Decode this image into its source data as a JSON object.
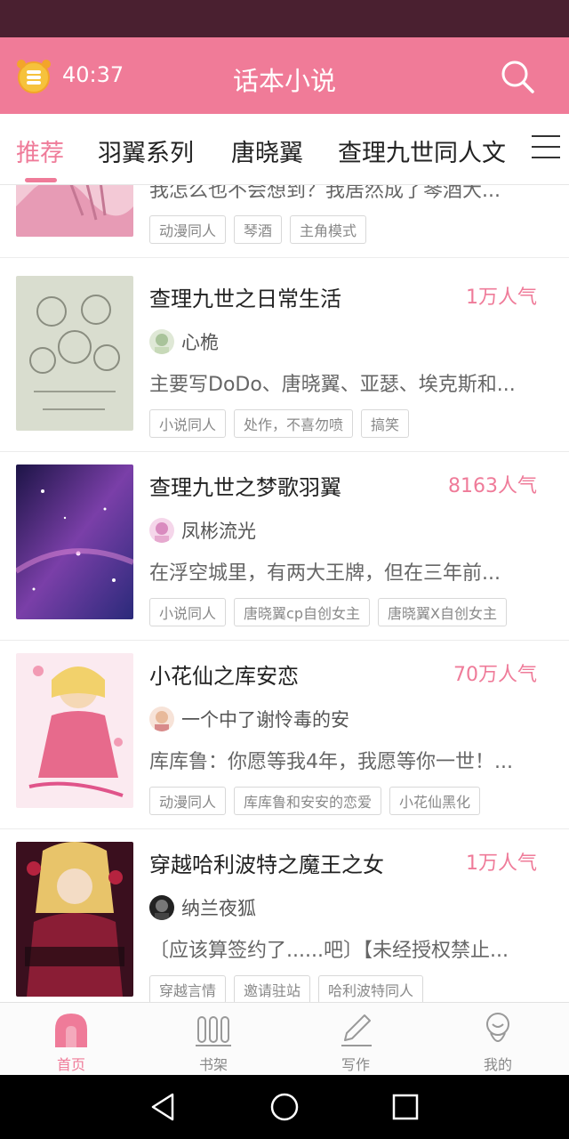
{
  "header": {
    "timer": "40:37",
    "title": "话本小说"
  },
  "tabs": [
    {
      "label": "推荐",
      "active": true
    },
    {
      "label": "羽翼系列",
      "active": false
    },
    {
      "label": "唐晓翼",
      "active": false
    },
    {
      "label": "查理九世同人文",
      "active": false
    }
  ],
  "books": [
    {
      "title": "",
      "popularity": "",
      "author": "",
      "intro": "我怎么也不会想到？我居然成了琴酒大...",
      "tags": [
        "动漫同人",
        "琴酒",
        "主角模式"
      ]
    },
    {
      "title": "查理九世之日常生活",
      "popularity": "1万人气",
      "author": "心桅",
      "intro": "主要写DoDo、唐晓翼、亚瑟、埃克斯和...",
      "tags": [
        "小说同人",
        "处作，不喜勿喷",
        "搞笑"
      ]
    },
    {
      "title": "查理九世之梦歌羽翼",
      "popularity": "8163人气",
      "author": "凤彬流光",
      "intro": "在浮空城里，有两大王牌，但在三年前...",
      "tags": [
        "小说同人",
        "唐晓翼cp自创女主",
        "唐晓翼X自创女主"
      ]
    },
    {
      "title": "小花仙之库安恋",
      "popularity": "70万人气",
      "author": "一个中了谢怜毒的安",
      "intro": "库库鲁：你愿等我4年，我愿等你一世！...",
      "tags": [
        "动漫同人",
        "库库鲁和安安的恋爱",
        "小花仙黑化"
      ]
    },
    {
      "title": "穿越哈利波特之魔王之女",
      "popularity": "1万人气",
      "author": "纳兰夜狐",
      "intro": "〔应该算签约了......吧〕【未经授权禁止...",
      "tags": [
        "穿越言情",
        "邀请驻站",
        "哈利波特同人"
      ]
    }
  ],
  "bottom_nav": [
    {
      "label": "首页",
      "icon": "home-icon",
      "active": true
    },
    {
      "label": "书架",
      "icon": "bookshelf-icon",
      "active": false
    },
    {
      "label": "写作",
      "icon": "pen-icon",
      "active": false
    },
    {
      "label": "我的",
      "icon": "profile-icon",
      "active": false
    }
  ],
  "colors": {
    "accent": "#ef7b99",
    "header": "#f07b98",
    "status_bar": "#4a2030"
  }
}
